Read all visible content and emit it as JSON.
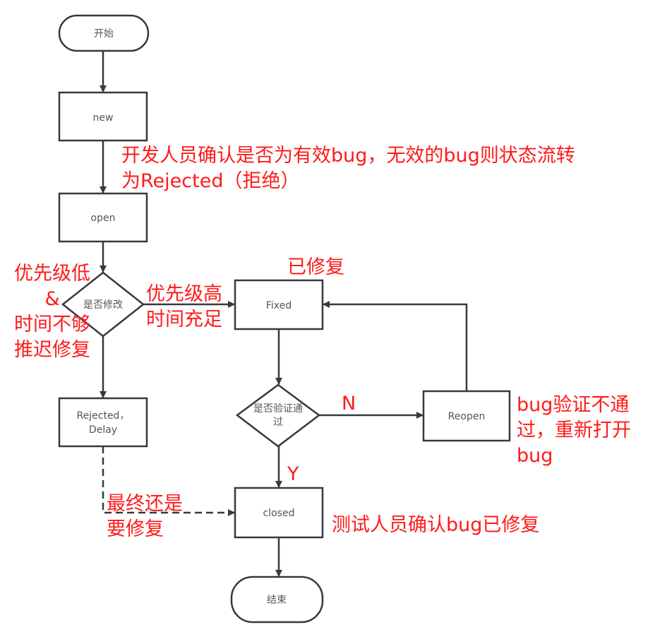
{
  "colors": {
    "stroke": "#333a40",
    "node_text": "#555555",
    "annotation": "#ff1a1a",
    "background": "#ffffff"
  },
  "nodes": {
    "start": "开始",
    "new": "new",
    "open": "open",
    "decision_fix": "是否修改",
    "fixed": "Fixed",
    "rejected_line1": "Rejected，",
    "rejected_line2": "Delay",
    "decision_verify_line1": "是否验证通",
    "decision_verify_line2": "过",
    "reopen": "Reopen",
    "closed": "closed",
    "end": "结束"
  },
  "annotations": {
    "dev_confirm": [
      "开发人员确认是否为有效bug，无效的bug则状态流转",
      "为Rejected（拒绝）"
    ],
    "low_priority": [
      "优先级低",
      "&",
      "时间不够",
      "推迟修复"
    ],
    "high_priority": [
      "优先级高",
      "时间充足"
    ],
    "fixed_label": "已修复",
    "no_label": "N",
    "yes_label": "Y",
    "reopen_note": [
      "bug验证不通",
      "过，重新打开",
      "bug"
    ],
    "eventually_fix": [
      "最终还是",
      "要修复"
    ],
    "tester_confirm": "测试人员确认bug已修复"
  }
}
